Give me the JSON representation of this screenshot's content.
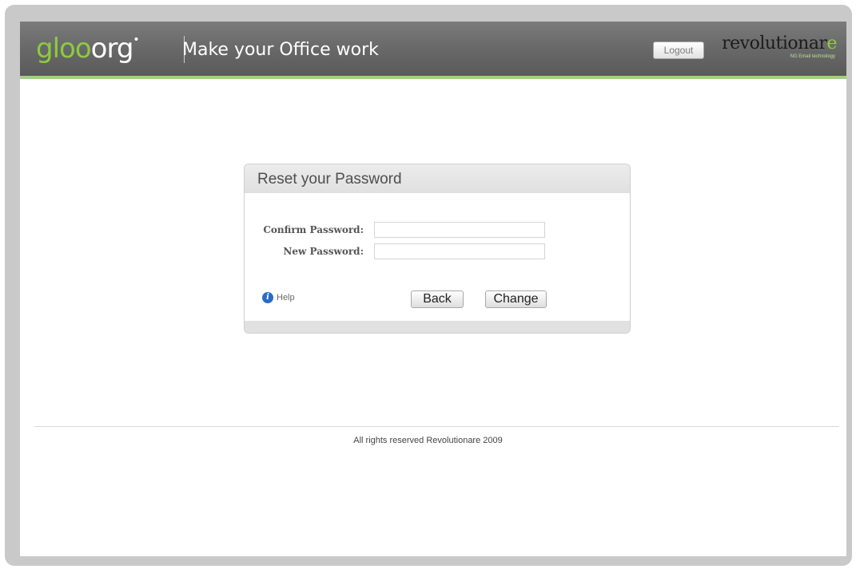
{
  "header": {
    "logo_part1": "gloo",
    "logo_part2": "org",
    "logo_mark": "•",
    "tagline": "Make your Office work",
    "logout_label": "Logout",
    "brand_name_main": "revolutionar",
    "brand_name_e": "e",
    "brand_subtitle": "NG Email technology"
  },
  "panel": {
    "title": "Reset your Password",
    "fields": [
      {
        "label": "Confirm Password:",
        "value": ""
      },
      {
        "label": "New Password:",
        "value": ""
      }
    ],
    "help_label": "Help",
    "help_icon": "info-icon",
    "back_label": "Back",
    "change_label": "Change"
  },
  "footer": {
    "text": "All rights reserved Revolutionare 2009"
  },
  "colors": {
    "accent_green": "#8ccb3e",
    "header_bar": "#6a6a6a",
    "header_underline": "#9fcf86",
    "info_blue": "#2a6bc4"
  }
}
